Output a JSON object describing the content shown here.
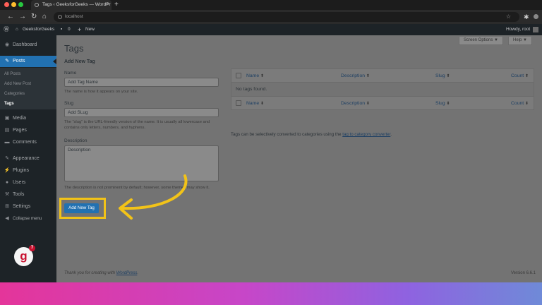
{
  "browser": {
    "tab_title": "Tags ‹ GeeksforGeeks — WordPr",
    "tab_close": "×",
    "new_tab": "+",
    "url": "localhost",
    "dots": [
      "#ff5f57",
      "#febc2e",
      "#28c840"
    ]
  },
  "adminbar": {
    "site": "GeeksforGeeks",
    "comments": "0",
    "new": "New",
    "howdy": "Howdy, root"
  },
  "sidebar": {
    "items": [
      {
        "label": "Dashboard",
        "icon": "dashboard-icon",
        "glyph": "◉"
      },
      {
        "label": "Posts",
        "icon": "pin-icon",
        "glyph": "✎",
        "active": true
      },
      {
        "label": "Media",
        "icon": "media-icon",
        "glyph": "▣"
      },
      {
        "label": "Pages",
        "icon": "pages-icon",
        "glyph": "▤"
      },
      {
        "label": "Comments",
        "icon": "comments-icon",
        "glyph": "▬"
      },
      {
        "label": "Appearance",
        "icon": "appearance-icon",
        "glyph": "✎"
      },
      {
        "label": "Plugins",
        "icon": "plugins-icon",
        "glyph": "⚡"
      },
      {
        "label": "Users",
        "icon": "users-icon",
        "glyph": "●"
      },
      {
        "label": "Tools",
        "icon": "tools-icon",
        "glyph": "⚒"
      },
      {
        "label": "Settings",
        "icon": "settings-icon",
        "glyph": "⊞"
      },
      {
        "label": "Collapse menu",
        "icon": "collapse-icon",
        "glyph": "◀"
      }
    ],
    "submenu": [
      "All Posts",
      "Add New Post",
      "Categories",
      "Tags"
    ],
    "logo_letter": "g",
    "logo_badge": "7"
  },
  "page": {
    "title": "Tags",
    "screen_options": "Screen Options ▼",
    "help": "Help ▼",
    "form_title": "Add New Tag",
    "name_label": "Name",
    "name_value": "Add Tag Name",
    "name_help": "The name is how it appears on your site.",
    "slug_label": "Slug",
    "slug_value": "Add SLug",
    "slug_help": "The “slug” is the URL-friendly version of the name. It is usually all lowercase and contains only letters, numbers, and hyphens.",
    "desc_label": "Description",
    "desc_value": "Description",
    "desc_help": "The description is not prominent by default; however, some themes may show it.",
    "add_button": "Add New Tag"
  },
  "table": {
    "columns": [
      "Name",
      "Description",
      "Slug",
      "Count"
    ],
    "sort_glyph": "⬍",
    "empty": "No tags found.",
    "tip_prefix": "Tags can be selectively converted to categories using the ",
    "tip_link": "tag to category converter",
    "tip_suffix": "."
  },
  "footer": {
    "thanks": "Thank you for creating with ",
    "wp_link": "WordPress",
    "thanks_end": ".",
    "version": "Version 6.6.1"
  },
  "colors": {
    "accent": "#2271b1",
    "highlight": "#f2c318",
    "arrow": "#f2c318"
  }
}
